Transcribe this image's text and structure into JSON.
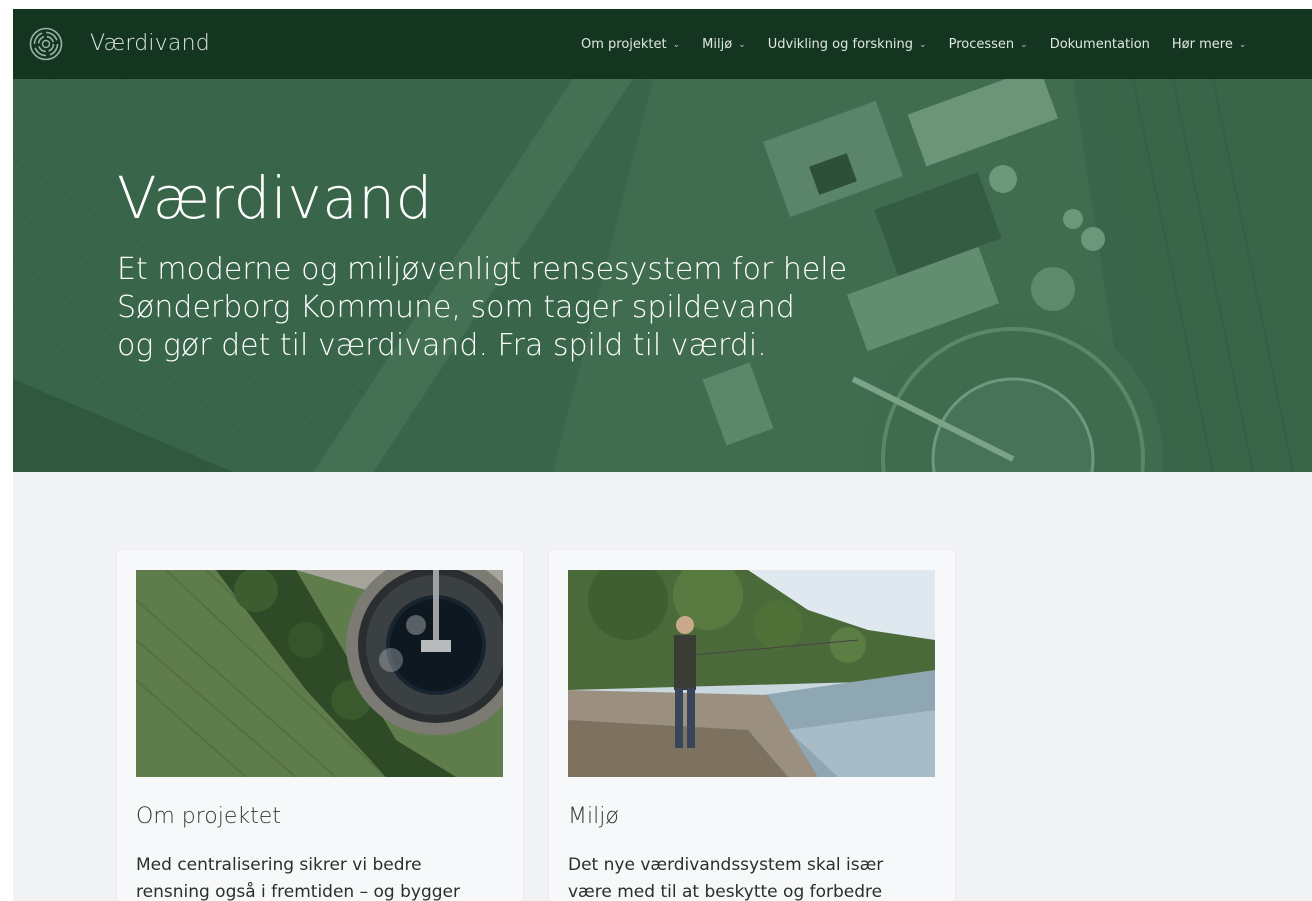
{
  "brand": {
    "name": "Værdivand"
  },
  "nav": {
    "items": [
      {
        "label": "Om projektet",
        "dropdown": true
      },
      {
        "label": "Miljø",
        "dropdown": true
      },
      {
        "label": "Udvikling og forskning",
        "dropdown": true
      },
      {
        "label": "Processen",
        "dropdown": true
      },
      {
        "label": "Dokumentation",
        "dropdown": false
      },
      {
        "label": "Hør mere",
        "dropdown": true
      }
    ]
  },
  "hero": {
    "title": "Værdivand",
    "subtitle_lines": [
      "Et moderne og miljøvenligt rensesystem for hele",
      "Sønderborg Kommune, som tager spildevand",
      "og gør det til værdivand. Fra spild til værdi."
    ]
  },
  "cards": [
    {
      "title": "Om projektet",
      "text": "Med centralisering sikrer vi bedre rensning også i fremtiden – og bygger"
    },
    {
      "title": "Miljø",
      "text": "Det nye værdivandssystem skal især være med til at beskytte og forbedre"
    }
  ],
  "colors": {
    "nav_bg": "#143621",
    "hero_overlay": "#39664a",
    "page_bg": "#f2f3f5"
  }
}
